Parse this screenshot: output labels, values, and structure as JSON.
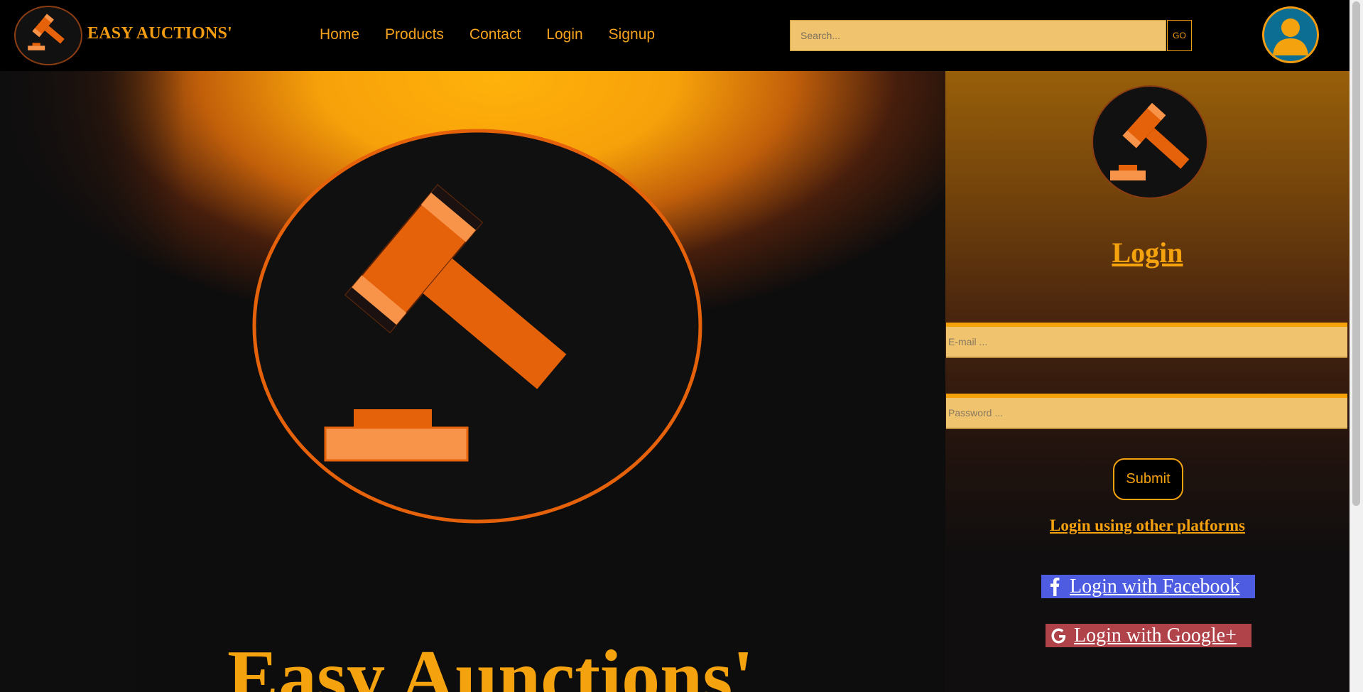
{
  "navbar": {
    "brand": "EASY AUCTIONS'",
    "links": [
      {
        "label": "Home"
      },
      {
        "label": "Products"
      },
      {
        "label": "Contact"
      },
      {
        "label": "Login"
      },
      {
        "label": "Signup"
      }
    ],
    "search": {
      "placeholder": "Search...",
      "value": "",
      "button_label": "GO"
    },
    "icons": {
      "logo": "gavel-icon",
      "avatar": "user-icon"
    }
  },
  "hero": {
    "title": "Easy Aunctions'",
    "icon": "gavel-icon"
  },
  "login": {
    "title": "Login",
    "email": {
      "placeholder": "E-mail ...",
      "value": ""
    },
    "password": {
      "placeholder": "Password ...",
      "value": ""
    },
    "submit_label": "Submit",
    "other_platforms": "Login using other platforms",
    "facebook": {
      "label": "Login with Facebook",
      "icon": "facebook-icon"
    },
    "google": {
      "label": "Login with Google+",
      "icon": "google-icon"
    }
  },
  "colors": {
    "accent": "#f5a20f",
    "gavel": "#e5620a",
    "gavel_light": "#f7944a",
    "input_bg": "#f0c46e",
    "facebook_bg": "#4d5ce0",
    "google_bg": "#b0424a",
    "avatar_bg": "#0d6e94"
  }
}
